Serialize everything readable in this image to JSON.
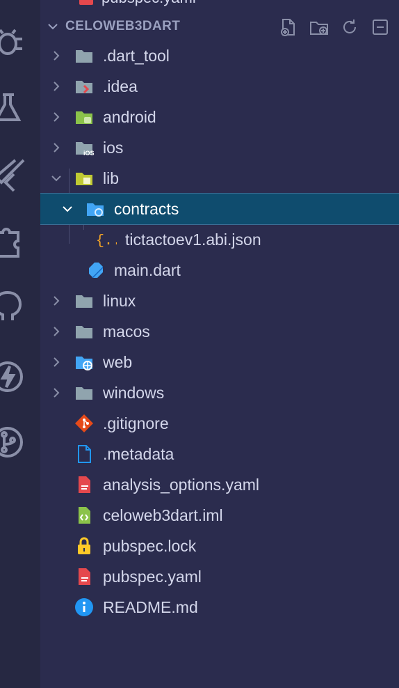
{
  "previous_item": {
    "label": "pubspec.yaml"
  },
  "explorer": {
    "section_title": "CELOWEB3DART",
    "actions": [
      {
        "name": "new-file-icon"
      },
      {
        "name": "new-folder-icon"
      },
      {
        "name": "refresh-icon"
      },
      {
        "name": "collapse-all-icon"
      }
    ]
  },
  "tree": [
    {
      "label": ".dart_tool",
      "type": "folder",
      "icon": "folder-icon",
      "expanded": false,
      "depth": 0
    },
    {
      "label": ".idea",
      "type": "folder",
      "icon": "idea-folder-icon",
      "expanded": false,
      "depth": 0
    },
    {
      "label": "android",
      "type": "folder",
      "icon": "android-folder-icon",
      "expanded": false,
      "depth": 0
    },
    {
      "label": "ios",
      "type": "folder",
      "icon": "ios-folder-icon",
      "expanded": false,
      "depth": 0
    },
    {
      "label": "lib",
      "type": "folder",
      "icon": "lib-folder-icon",
      "expanded": true,
      "depth": 0
    },
    {
      "label": "contracts",
      "type": "folder",
      "icon": "contracts-folder-icon",
      "expanded": true,
      "depth": 1,
      "selected": true
    },
    {
      "label": "tictactoev1.abi.json",
      "type": "file",
      "icon": "json-file-icon",
      "depth": 2
    },
    {
      "label": "main.dart",
      "type": "file",
      "icon": "dart-file-icon",
      "depth": 1
    },
    {
      "label": "linux",
      "type": "folder",
      "icon": "folder-icon",
      "expanded": false,
      "depth": 0
    },
    {
      "label": "macos",
      "type": "folder",
      "icon": "folder-icon",
      "expanded": false,
      "depth": 0
    },
    {
      "label": "web",
      "type": "folder",
      "icon": "web-folder-icon",
      "expanded": false,
      "depth": 0
    },
    {
      "label": "windows",
      "type": "folder",
      "icon": "folder-icon",
      "expanded": false,
      "depth": 0
    },
    {
      "label": ".gitignore",
      "type": "file",
      "icon": "git-icon",
      "depth": 0
    },
    {
      "label": ".metadata",
      "type": "file",
      "icon": "file-icon",
      "depth": 0
    },
    {
      "label": "analysis_options.yaml",
      "type": "file",
      "icon": "yaml-file-icon",
      "depth": 0
    },
    {
      "label": "celoweb3dart.iml",
      "type": "file",
      "icon": "iml-file-icon",
      "depth": 0
    },
    {
      "label": "pubspec.lock",
      "type": "file",
      "icon": "lock-icon",
      "depth": 0
    },
    {
      "label": "pubspec.yaml",
      "type": "file",
      "icon": "yaml-file-icon",
      "depth": 0
    },
    {
      "label": "README.md",
      "type": "file",
      "icon": "info-icon",
      "depth": 0
    }
  ],
  "activity_bar": [
    {
      "name": "debug-icon"
    },
    {
      "name": "testing-icon"
    },
    {
      "name": "flutter-icon"
    },
    {
      "name": "extensions-icon"
    },
    {
      "name": "github-icon"
    },
    {
      "name": "lightning-icon"
    },
    {
      "name": "source-control-icon"
    }
  ],
  "colors": {
    "background": "#2b2c4e",
    "activity_bar": "#262842",
    "selection": "#0f4c6e",
    "folder": "#90a4ae",
    "android": "#8bc34a",
    "lib": "#c0ca33",
    "contracts": "#42a5f5",
    "json": "#f9a825",
    "yaml": "#e5484d",
    "git": "#e64a19",
    "lock": "#ffca28",
    "info": "#2196f3"
  }
}
